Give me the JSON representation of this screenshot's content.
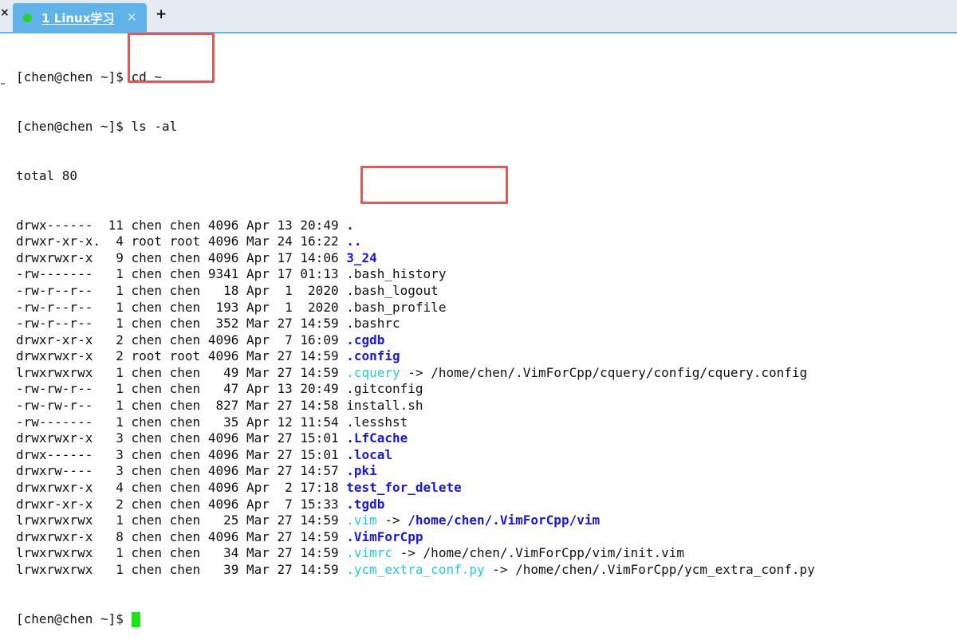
{
  "tabbar": {
    "close_glyph": "×",
    "tab": {
      "title": "1 Linux学习",
      "close_glyph": "×",
      "status": "connected"
    },
    "new_tab_glyph": "+"
  },
  "terminal": {
    "prompt": "[chen@chen ~]$",
    "commands": [
      {
        "prompt": "[chen@chen ~]$",
        "text": " cd ~"
      },
      {
        "prompt": "[chen@chen ~]$",
        "text": " ls -al"
      }
    ],
    "total_line": "total 80",
    "entries": [
      {
        "meta": "drwx------  11 chen chen 4096 Apr 13 20:49 ",
        "name": ".",
        "type": "dir"
      },
      {
        "meta": "drwxr-xr-x.  4 root root 4096 Mar 24 16:22 ",
        "name": "..",
        "type": "dir"
      },
      {
        "meta": "drwxrwxr-x   9 chen chen 4096 Apr 17 14:06 ",
        "name": "3_24",
        "type": "dir"
      },
      {
        "meta": "-rw-------   1 chen chen 9341 Apr 17 01:13 ",
        "name": ".bash_history",
        "type": "file"
      },
      {
        "meta": "-rw-r--r--   1 chen chen   18 Apr  1  2020 ",
        "name": ".bash_logout",
        "type": "file"
      },
      {
        "meta": "-rw-r--r--   1 chen chen  193 Apr  1  2020 ",
        "name": ".bash_profile",
        "type": "file"
      },
      {
        "meta": "-rw-r--r--   1 chen chen  352 Mar 27 14:59 ",
        "name": ".bashrc",
        "type": "file"
      },
      {
        "meta": "drwxr-xr-x   2 chen chen 4096 Apr  7 16:09 ",
        "name": ".cgdb",
        "type": "dir"
      },
      {
        "meta": "drwxrwxr-x   2 root root 4096 Mar 27 14:59 ",
        "name": ".config",
        "type": "dir"
      },
      {
        "meta": "lrwxrwxrwx   1 chen chen   49 Mar 27 14:59 ",
        "name": ".cquery",
        "type": "link",
        "arrow": " -> ",
        "target": "/home/chen/.VimForCpp/cquery/config/cquery.config",
        "target_type": "file"
      },
      {
        "meta": "-rw-rw-r--   1 chen chen   47 Apr 13 20:49 ",
        "name": ".gitconfig",
        "type": "file"
      },
      {
        "meta": "-rw-rw-r--   1 chen chen  827 Mar 27 14:58 ",
        "name": "install.sh",
        "type": "file"
      },
      {
        "meta": "-rw-------   1 chen chen   35 Apr 12 11:54 ",
        "name": ".lesshst",
        "type": "file"
      },
      {
        "meta": "drwxrwxr-x   3 chen chen 4096 Mar 27 15:01 ",
        "name": ".LfCache",
        "type": "dir"
      },
      {
        "meta": "drwx------   3 chen chen 4096 Mar 27 15:01 ",
        "name": ".local",
        "type": "dir"
      },
      {
        "meta": "drwxrw----   3 chen chen 4096 Mar 27 14:57 ",
        "name": ".pki",
        "type": "dir"
      },
      {
        "meta": "drwxrwxr-x   4 chen chen 4096 Apr  2 17:18 ",
        "name": "test_for_delete",
        "type": "dir"
      },
      {
        "meta": "drwxr-xr-x   2 chen chen 4096 Apr  7 15:33 ",
        "name": ".tgdb",
        "type": "dir"
      },
      {
        "meta": "lrwxrwxrwx   1 chen chen   25 Mar 27 14:59 ",
        "name": ".vim",
        "type": "link",
        "arrow": " -> ",
        "target": "/home/chen/.VimForCpp/vim",
        "target_type": "dir"
      },
      {
        "meta": "drwxrwxr-x   8 chen chen 4096 Mar 27 14:59 ",
        "name": ".VimForCpp",
        "type": "dir"
      },
      {
        "meta": "lrwxrwxrwx   1 chen chen   34 Mar 27 14:59 ",
        "name": ".vimrc",
        "type": "link",
        "arrow": " -> ",
        "target": "/home/chen/.VimForCpp/vim/init.vim",
        "target_type": "file"
      },
      {
        "meta": "lrwxrwxrwx   1 chen chen   39 Mar 27 14:59 ",
        "name": ".ycm_extra_conf.py",
        "type": "link",
        "arrow": " -> ",
        "target": "/home/chen/.VimForCpp/ycm_extra_conf.py",
        "target_type": "file"
      }
    ],
    "final_prompt": "[chen@chen ~]$ "
  },
  "colors": {
    "directory": "#1818d6",
    "symlink": "#23c8e6",
    "highlight_box": "#e15a5a",
    "cursor": "#17e617",
    "tab_active": "#5fb3e8",
    "status_dot": "#2ad12a"
  }
}
